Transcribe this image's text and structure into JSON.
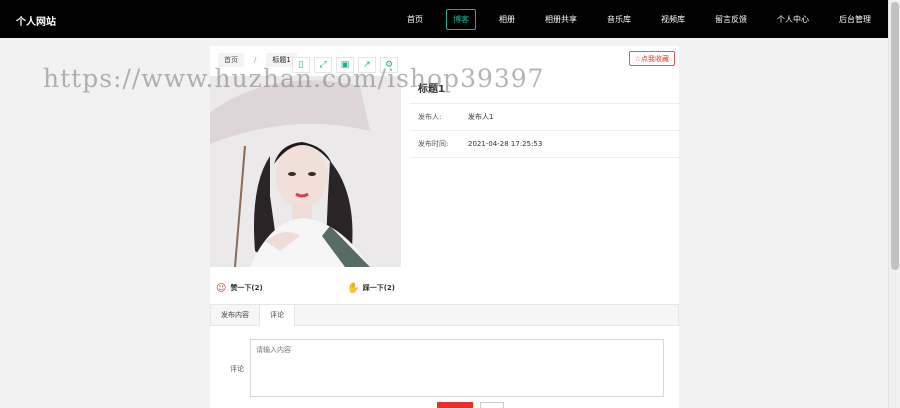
{
  "brand": "个人网站",
  "nav": [
    {
      "label": "首页",
      "active": false
    },
    {
      "label": "博客",
      "active": true
    },
    {
      "label": "相册",
      "active": false
    },
    {
      "label": "相册共享",
      "active": false
    },
    {
      "label": "音乐库",
      "active": false
    },
    {
      "label": "视频库",
      "active": false
    },
    {
      "label": "留言反馈",
      "active": false
    },
    {
      "label": "个人中心",
      "active": false
    },
    {
      "label": "后台管理",
      "active": false
    }
  ],
  "breadcrumb": {
    "home": "首页",
    "separator": "/",
    "current": "标题1"
  },
  "favorite_label": "☆点我收藏",
  "post": {
    "title": "标题1",
    "publisher_label": "发布人:",
    "publisher": "发布人1",
    "time_label": "发布时间:",
    "time": "2021-04-28 17:25:53"
  },
  "reactions": {
    "like_label": "赞一下(2)",
    "dislike_label": "踩一下(2)"
  },
  "tabs": [
    {
      "label": "发布内容",
      "active": false
    },
    {
      "label": "评论",
      "active": true
    }
  ],
  "comment": {
    "label": "评论",
    "placeholder": "请输入内容"
  },
  "watermark": "https://www.huzhan.com/ishop39397",
  "colors": {
    "accent": "#19b394",
    "danger": "#e0312b",
    "nav_bg": "#000000"
  }
}
